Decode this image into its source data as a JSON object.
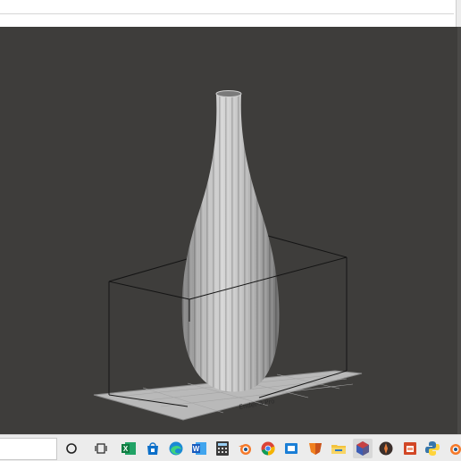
{
  "window": {
    "title": ""
  },
  "viewport": {
    "background_color": "#3e3d3b",
    "build_volume_color": "#111111",
    "plate_color": "#b9b9b9",
    "model_color": "#bdbdbd",
    "model_type": "fluted bottle vase",
    "plate_label": "Ender-3 Pro"
  },
  "taskbar": {
    "search_placeholder": "",
    "icons": [
      {
        "name": "cortana-icon"
      },
      {
        "name": "task-view-icon"
      },
      {
        "name": "excel-icon"
      },
      {
        "name": "ms-store-icon"
      },
      {
        "name": "edge-icon"
      },
      {
        "name": "word-icon"
      },
      {
        "name": "calculator-icon"
      },
      {
        "name": "blender-icon"
      },
      {
        "name": "chrome-icon"
      },
      {
        "name": "blue-app-icon"
      },
      {
        "name": "orange-shield-icon"
      },
      {
        "name": "file-explorer-icon"
      },
      {
        "name": "slicer-icon"
      },
      {
        "name": "dark-circle-app-icon"
      },
      {
        "name": "powerpoint-icon"
      },
      {
        "name": "python-icon"
      },
      {
        "name": "blender-2-icon"
      }
    ]
  }
}
